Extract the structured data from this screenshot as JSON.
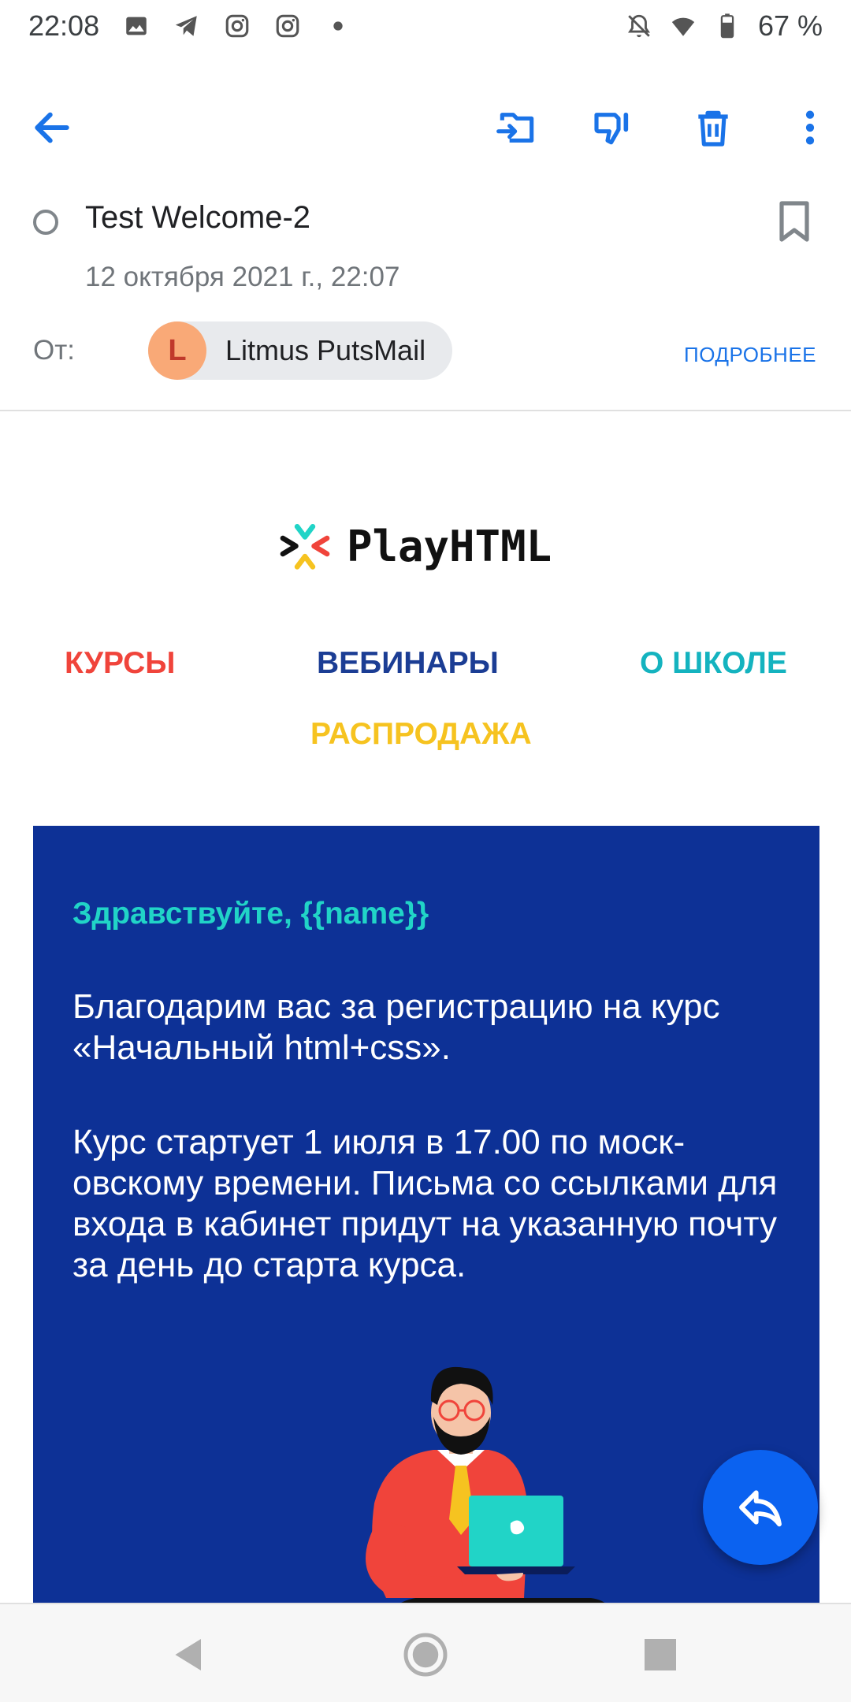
{
  "status_bar": {
    "time": "22:08",
    "battery": "67 %",
    "left_icons": [
      "image-icon",
      "telegram-icon",
      "instagram-icon",
      "instagram-icon",
      "dot-icon"
    ],
    "right_icons": [
      "mute-icon",
      "wifi-icon",
      "battery-icon"
    ]
  },
  "toolbar": {
    "icons": [
      "back-arrow-icon",
      "move-to-folder-icon",
      "spam-icon",
      "trash-icon",
      "more-icon"
    ],
    "accent_color": "#1a73e8"
  },
  "mail": {
    "subject": "Test Welcome-2",
    "date": "12 октября 2021 г., 22:07",
    "from_label": "От:",
    "sender_initial": "L",
    "sender_name": "Litmus PutsMail",
    "details_link": "ПОДРОБНЕЕ"
  },
  "email_body": {
    "logo_text": "PlayHTML",
    "nav": {
      "courses": "КУРСЫ",
      "webinars": "ВЕБИНАРЫ",
      "about_school": "О ШКОЛЕ",
      "sale": "РАСПРОДАЖА"
    },
    "greeting": "Здравствуйте, {{name}}",
    "paragraph_1": "Благодарим вас за регистрацию на курс «Начальный html+css».",
    "paragraph_2": "Курс стартует 1 июля в 17.00 по моск-овскому времени. Письма со ссылками для входа в кабинет придут на указанную почту за день до старта курса.",
    "colors": {
      "card_bg": "#0d3196",
      "greeting": "#21d4c7",
      "courses": "#f0443b",
      "webinars": "#1b3d94",
      "school": "#14b3bf",
      "sale": "#f6c320"
    }
  },
  "fab": {
    "icon": "reply-icon",
    "color": "#0b62f0"
  },
  "nav_bar": {
    "icons": [
      "back-triangle-icon",
      "home-circle-icon",
      "recents-square-icon"
    ]
  }
}
